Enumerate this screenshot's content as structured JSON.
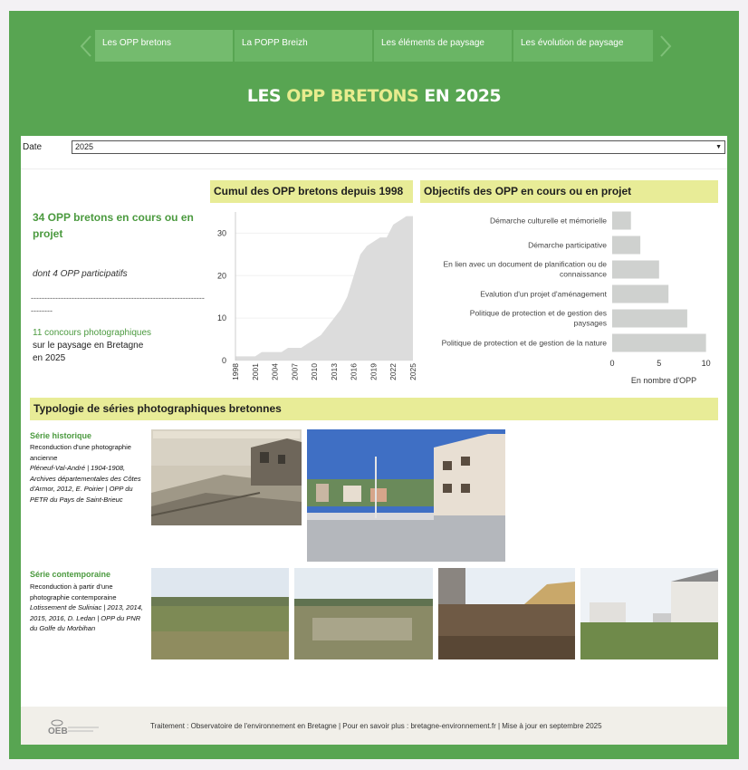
{
  "tabs": [
    {
      "label": "Les OPP bretons",
      "active": true
    },
    {
      "label": "La POPP Breizh",
      "active": false
    },
    {
      "label": "Les éléments de paysage",
      "active": false
    },
    {
      "label": "Les évolution de paysage",
      "active": false
    }
  ],
  "title": {
    "part1": "LES ",
    "highlight": "OPP BRETONS",
    "part2": " EN 2025"
  },
  "filter": {
    "label": "Date",
    "value": "2025"
  },
  "kpi": {
    "main": "34 OPP bretons en cours ou en projet",
    "participatifs": "dont 4 OPP participatifs",
    "divider": "------------------------------------------------------------------------",
    "contest_highlight": "11 concours photographiques",
    "contest_rest1": "sur le paysage en Bretagne",
    "contest_rest2": "en 2025"
  },
  "cumul": {
    "title": "Cumul des OPP bretons depuis 1998"
  },
  "objectifs": {
    "title": "Objectifs des OPP en cours ou en projet",
    "xlabel": "En nombre d'OPP"
  },
  "chart_data": [
    {
      "type": "area",
      "title": "Cumul des OPP bretons depuis 1998",
      "x": [
        "1998",
        "1999",
        "2000",
        "2001",
        "2002",
        "2003",
        "2004",
        "2005",
        "2006",
        "2007",
        "2008",
        "2009",
        "2010",
        "2011",
        "2012",
        "2013",
        "2014",
        "2015",
        "2016",
        "2017",
        "2018",
        "2019",
        "2020",
        "2021",
        "2022",
        "2023",
        "2024",
        "2025"
      ],
      "values": [
        1,
        1,
        1,
        1,
        2,
        2,
        2,
        2,
        3,
        3,
        3,
        4,
        5,
        6,
        8,
        10,
        12,
        15,
        20,
        25,
        27,
        28,
        29,
        29,
        32,
        33,
        34,
        34
      ],
      "xticks": [
        "1998",
        "2001",
        "2004",
        "2007",
        "2010",
        "2013",
        "2016",
        "2019",
        "2022",
        "2025"
      ],
      "ylim": [
        0,
        35
      ],
      "yticks": [
        0,
        10,
        20,
        30
      ],
      "color": "#dcdcdc"
    },
    {
      "type": "bar",
      "orientation": "horizontal",
      "title": "Objectifs des OPP en cours ou en projet",
      "categories": [
        "Démarche culturelle et mémorielle",
        "Démarche participative",
        "En lien avec un document de planification ou de connaissance",
        "Evalution d'un projet d'aménagement",
        "Politique de protection et de gestion des paysages",
        "Politique de protection et de gestion de la nature"
      ],
      "values": [
        2,
        3,
        5,
        6,
        8,
        10
      ],
      "xlabel": "En nombre d'OPP",
      "xlim": [
        0,
        11
      ],
      "xticks": [
        0,
        5,
        10
      ],
      "color": "#cfd1cf"
    }
  ],
  "typologie": {
    "title": "Typologie de séries photographiques bretonnes",
    "historique": {
      "title": "Série historique",
      "desc": "Reconduction d'une photographie ancienne",
      "caption": "Pléneuf-Val-André | 1904-1908, Archives départementales des Côtes d'Armor, 2012, E. Poirier | OPP du PETR du Pays de Saint-Brieuc"
    },
    "contemporaine": {
      "title": "Série contemporaine",
      "desc": "Reconduction à partir d'une photographie contemporaine",
      "caption": "Lotissement de Suliniac | 2013, 2014, 2015, 2016, D. Ledan | OPP du PNR du Golfe du Morbihan"
    }
  },
  "footer": {
    "text": "Traitement : Observatoire de l'environnement en Bretagne | Pour en savoir plus : bretagne-environnement.fr | Mise à jour en septembre 2025",
    "logo_text": "OEB"
  },
  "colors": {
    "frame": "#58a552",
    "header_band": "#e8ec97",
    "accent_green": "#4b9a3f",
    "title_highlight": "#e8ec8e"
  }
}
